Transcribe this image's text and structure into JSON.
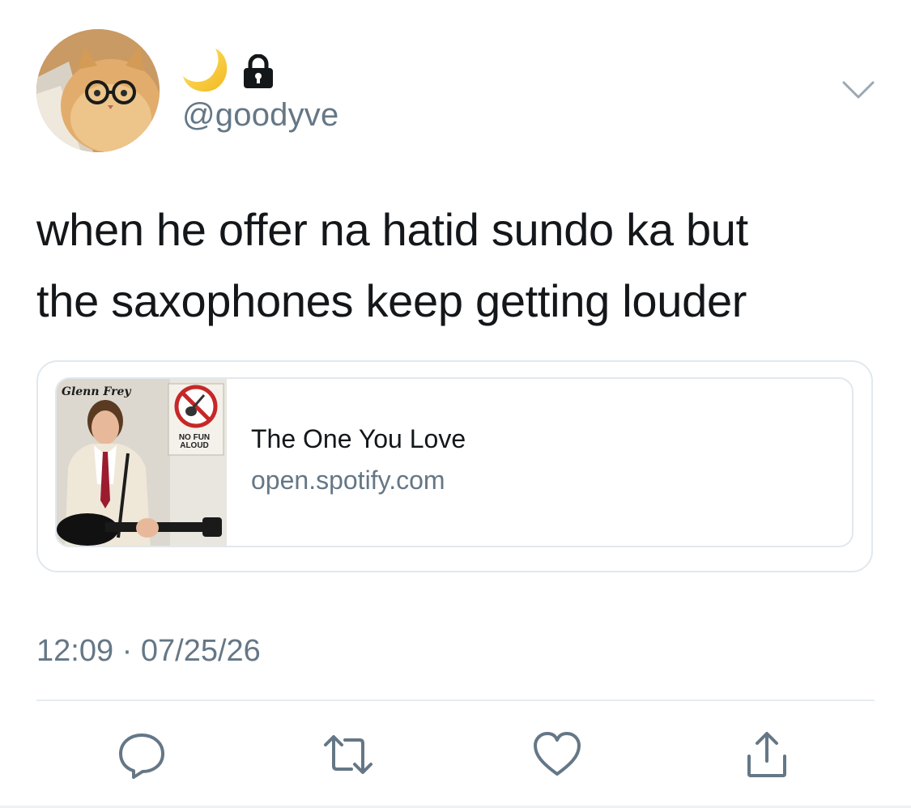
{
  "author": {
    "handle": "@goodyve",
    "display_name_icons": [
      "crescent-moon-emoji",
      "lock-icon"
    ],
    "protected": true
  },
  "tweet": {
    "text_line_1": "when he offer na hatid sundo ka but",
    "text_line_2": "the saxophones keep getting louder",
    "timestamp": "12:09 · 07/25/26"
  },
  "link_card": {
    "title": "The One You Love",
    "domain": "open.spotify.com",
    "album_artist_text": "Glenn Frey",
    "album_sign_text_1": "NO FUN",
    "album_sign_text_2": "ALOUD"
  },
  "actions": [
    "reply-icon",
    "retweet-icon",
    "like-icon",
    "share-icon"
  ],
  "colors": {
    "text_primary": "#14171a",
    "text_secondary": "#657786",
    "border": "#e1e8ed"
  }
}
